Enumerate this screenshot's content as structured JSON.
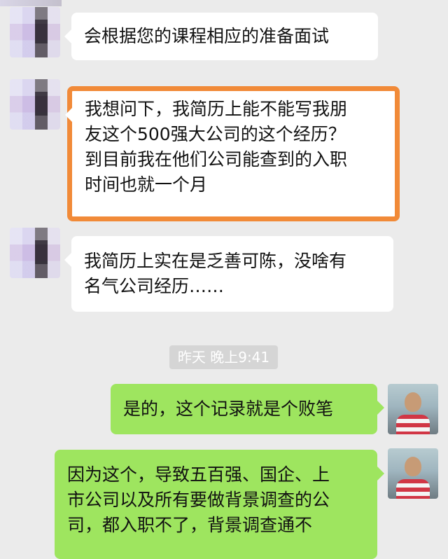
{
  "messages": [
    {
      "side": "left",
      "text": "会根据您的课程相应的准备面试",
      "avatar": "blurred-profile-photo"
    },
    {
      "side": "left",
      "text": "我想问下，我简历上能不能写我朋\n友这个500强大公司的这个经历？\n到目前我在他们公司能查到的入职\n时间也就一个月",
      "highlighted": true,
      "highlight_color": "#f18a38",
      "avatar": "blurred-profile-photo"
    },
    {
      "side": "left",
      "text": "我简历上实在是乏善可陈，没啥有\n名气公司经历……",
      "avatar": "blurred-profile-photo"
    },
    {
      "side": "right",
      "text": "是的，这个记录就是个败笔",
      "avatar": "profile-photo-man-striped-shirt"
    },
    {
      "side": "right",
      "text": "因为这个，导致五百强、国企、上\n市公司以及所有要做背景调查的公\n司，都入职不了，背景调查通不",
      "avatar": "profile-photo-man-striped-shirt"
    }
  ],
  "timestamp": "昨天 晚上9:41",
  "colors": {
    "background": "#ebebeb",
    "incoming_bubble": "#ffffff",
    "outgoing_bubble": "#9ee55f",
    "timestamp_bg": "#d5d5d5"
  }
}
